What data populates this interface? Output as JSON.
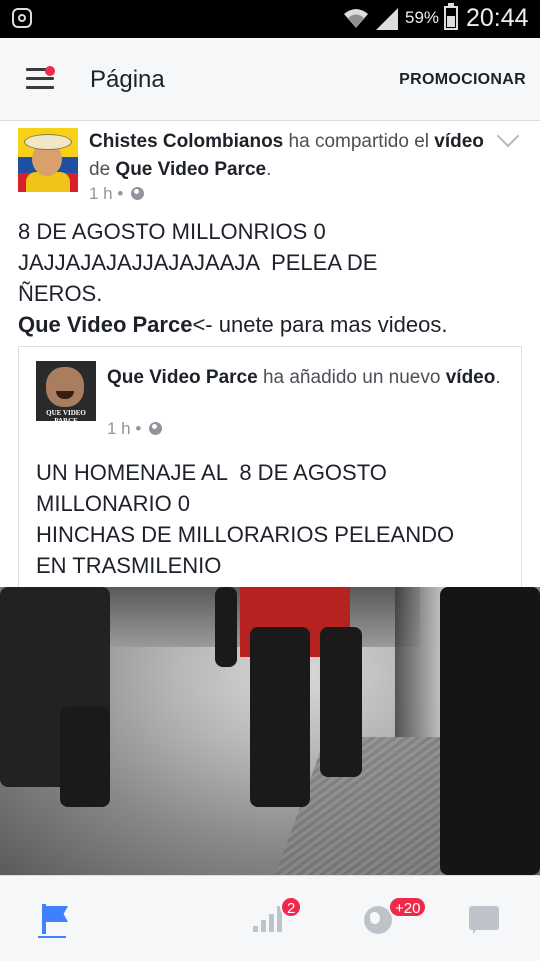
{
  "status_bar": {
    "battery": "59%",
    "time": "20:44"
  },
  "app_bar": {
    "title": "Página",
    "action": "PROMOCIONAR"
  },
  "post": {
    "author": "Chistes Colombianos",
    "action_text": " ha compartido el ",
    "object": "vídeo",
    "preposition": " de ",
    "source": "Que Video Parce",
    "period": ".",
    "time": "1 h",
    "separator": " • ",
    "text_lines": [
      "8 DE AGOSTO MILLONRIOS 0",
      "JAJJAJAJAJJAJAJAAJA  PELEA DE",
      "ÑEROS."
    ],
    "link_text": "Que Video Parce",
    "link_suffix": "<- unete para mas videos."
  },
  "shared": {
    "author": "Que Video Parce",
    "action_text": " ha añadido un nuevo ",
    "object": "vídeo",
    "period": ".",
    "avatar_caption": "QUE VIDEO PARCE",
    "time": "1 h",
    "separator": " • ",
    "text_lines": [
      "UN HOMENAJE AL  8 DE AGOSTO",
      "MILLONARIO 0",
      "HINCHAS DE MILLORARIOS PELEANDO",
      "EN TRASMILENIO"
    ]
  },
  "bottom_nav": {
    "items": [
      {
        "icon": "flag-icon",
        "active": true
      },
      {
        "icon": "bar-chart-icon",
        "active": false
      },
      {
        "icon": "messages-icon",
        "badge": "2"
      },
      {
        "icon": "globe-icon",
        "badge": "+20"
      },
      {
        "icon": "more-icon"
      }
    ]
  },
  "colors": {
    "accent": "#4080ff",
    "badge": "#f02849",
    "text": "#1d2129",
    "meta": "#90949c"
  }
}
